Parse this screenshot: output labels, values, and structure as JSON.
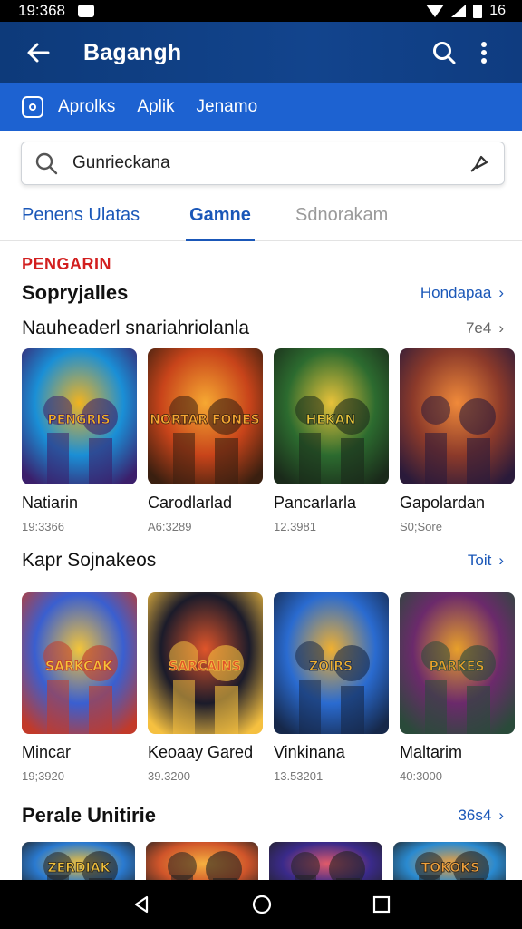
{
  "status": {
    "time": "19:368"
  },
  "appbar": {
    "title": "Bagangh"
  },
  "categories": {
    "items": [
      "Aprolks",
      "Aplik",
      "Jenamo"
    ]
  },
  "search": {
    "value": "Gunrieckana"
  },
  "tabs": [
    "Penens Ulatas",
    "Gamne",
    "Sdnorakam"
  ],
  "promo": "PENGARIN",
  "sections": [
    {
      "title": "Sopryjalles",
      "link": "Hondapaa",
      "subtitle": "Nauheaderl snariahriolanla",
      "subcount": "7e4",
      "apps": [
        {
          "name": "Natiarin",
          "meta": "19:3366",
          "art": "PENGRIS",
          "palette": [
            "#1a8fd6",
            "#f2b31f",
            "#3b1f6b"
          ]
        },
        {
          "name": "Carodlarlad",
          "meta": "A6:3289",
          "art": "NORTAR FONES",
          "palette": [
            "#c8441a",
            "#f6a832",
            "#3a1f10"
          ]
        },
        {
          "name": "Pancarlarla",
          "meta": "12.3981",
          "art": "HEKAN",
          "palette": [
            "#2c6b2f",
            "#e8c23a",
            "#1a2a1a"
          ]
        },
        {
          "name": "Gapolardan",
          "meta": "S0;Sore",
          "art": "",
          "palette": [
            "#8c3a2a",
            "#f08a3a",
            "#2a1a3a"
          ]
        }
      ]
    },
    {
      "title": "Kapr Sojnakeos",
      "link": "Toit",
      "apps": [
        {
          "name": "Mincar",
          "meta": "19;3920",
          "art": "SARKCAK",
          "palette": [
            "#3a5fd0",
            "#f3c53a",
            "#c23a2a"
          ]
        },
        {
          "name": "Keoaay Gared",
          "meta": "39.3200",
          "art": "SARCAINS",
          "palette": [
            "#1b1b2a",
            "#e0552a",
            "#f5c040"
          ]
        },
        {
          "name": "Vinkinana",
          "meta": "13.53201",
          "art": "ZOIRS",
          "palette": [
            "#2a6bd0",
            "#f0b030",
            "#16284a"
          ]
        },
        {
          "name": "Maltarim",
          "meta": "40:3000",
          "art": "PARKES",
          "palette": [
            "#6b2a6b",
            "#e8a02a",
            "#2a4a3a"
          ]
        }
      ]
    },
    {
      "title": "Perale Unitirie",
      "link": "36s4",
      "apps": [
        {
          "art": "ZERDIAK",
          "palette": [
            "#2a7ad0",
            "#f0c03a"
          ]
        },
        {
          "art": "",
          "palette": [
            "#d0552a",
            "#f5b040"
          ]
        },
        {
          "art": "",
          "palette": [
            "#3a2a8a",
            "#e05a6a"
          ]
        },
        {
          "art": "TOKOKS",
          "palette": [
            "#2a8ad0",
            "#f0a03a"
          ]
        }
      ]
    }
  ]
}
